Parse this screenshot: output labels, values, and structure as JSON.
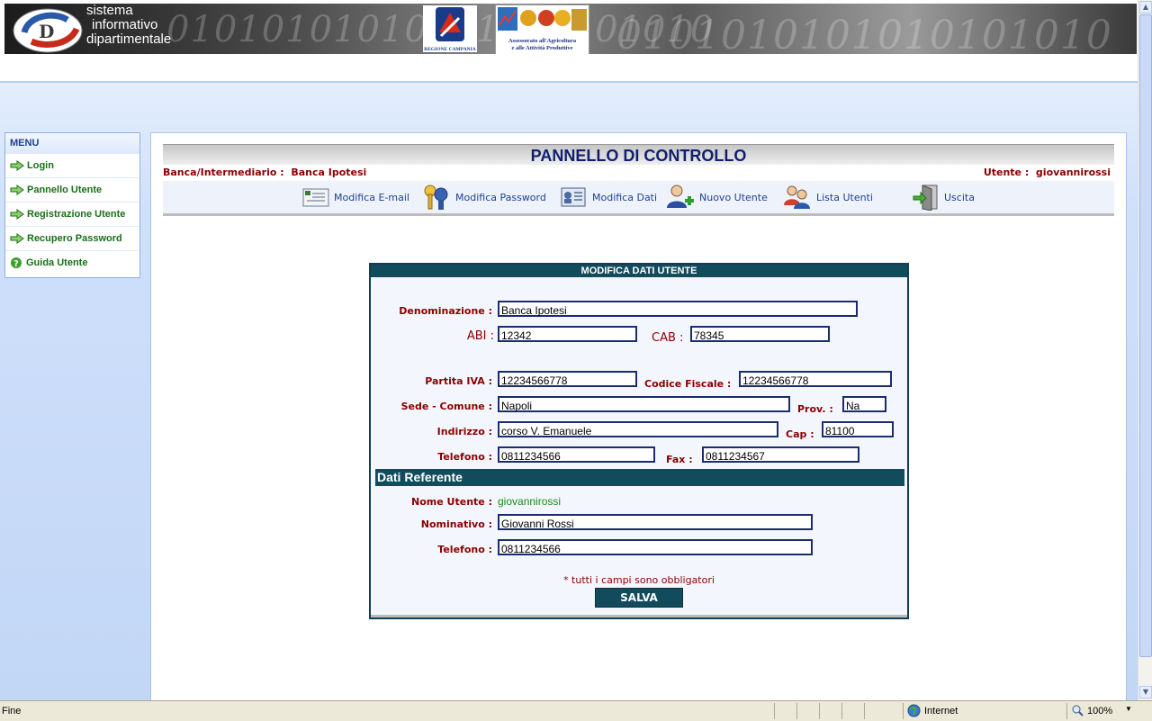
{
  "header": {
    "brand_line1": "sistema",
    "brand_line2": "informativo",
    "brand_line3": "dipartimentale",
    "binary_text": "01010101010101010101010",
    "binary_text2": "0101010101010101010",
    "region_label": "REGIONE CAMPANIA",
    "assessorato_line1": "Assessorato all'Agricoltura",
    "assessorato_line2": "e alle Attività Produttive"
  },
  "menu": {
    "title": "MENU",
    "items": [
      {
        "label": "Login",
        "icon": "arrow-right-icon"
      },
      {
        "label": "Pannello Utente",
        "icon": "arrow-right-icon"
      },
      {
        "label": "Registrazione Utente",
        "icon": "arrow-right-icon"
      },
      {
        "label": "Recupero Password",
        "icon": "arrow-right-icon"
      },
      {
        "label": "Guida Utente",
        "icon": "help-icon"
      }
    ]
  },
  "control_panel": {
    "title": "PANNELLO DI CONTROLLO",
    "bank_label": "Banca/Intermediario :",
    "bank_value": "Banca Ipotesi",
    "user_label": "Utente :",
    "user_value": "giovannirossi",
    "toolbar": [
      {
        "label": "Modifica E-mail",
        "icon": "email-icon"
      },
      {
        "label": "Modifica Password",
        "icon": "keys-icon"
      },
      {
        "label": "Modifica Dati",
        "icon": "id-card-icon"
      },
      {
        "label": "Nuovo Utente",
        "icon": "add-user-icon"
      },
      {
        "label": "Lista Utenti",
        "icon": "users-icon"
      },
      {
        "label": "Uscita",
        "icon": "exit-door-icon"
      }
    ]
  },
  "form": {
    "title": "MODIFICA DATI UTENTE",
    "denominazione": {
      "label": "Denominazione :",
      "value": "Banca Ipotesi"
    },
    "abi": {
      "label": "ABI :",
      "value": "12342"
    },
    "cab": {
      "label": "CAB :",
      "value": "78345"
    },
    "partita_iva": {
      "label": "Partita IVA :",
      "value": "12234566778"
    },
    "codice_fiscale": {
      "label": "Codice Fiscale :",
      "value": "12234566778"
    },
    "sede_comune": {
      "label": "Sede - Comune :",
      "value": "Napoli"
    },
    "prov": {
      "label": "Prov. :",
      "value": "Na"
    },
    "indirizzo": {
      "label": "Indirizzo :",
      "value": "corso V. Emanuele"
    },
    "cap": {
      "label": "Cap :",
      "value": "81100"
    },
    "telefono": {
      "label": "Telefono :",
      "value": "0811234566"
    },
    "fax": {
      "label": "Fax :",
      "value": "0811234567"
    },
    "section_referente": "Dati Referente",
    "nome_utente": {
      "label": "Nome Utente :",
      "value": "giovannirossi"
    },
    "nominativo": {
      "label": "Nominativo :",
      "value": "Giovanni Rossi"
    },
    "telefono_ref": {
      "label": "Telefono :",
      "value": "0811234566"
    },
    "note": "* tutti i campi sono obbligatori",
    "save_label": "SALVA"
  },
  "statusbar": {
    "status": "Fine",
    "zone": "Internet",
    "zoom": "100%"
  }
}
